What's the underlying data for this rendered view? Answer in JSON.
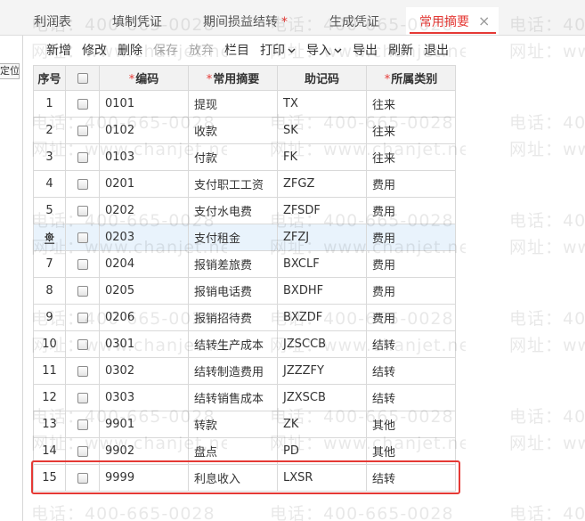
{
  "tabs": [
    {
      "label": "利润表"
    },
    {
      "label": "填制凭证"
    },
    {
      "label": "期间损益结转",
      "modified_mark": "*"
    },
    {
      "label": "生成凭证"
    },
    {
      "label": "常用摘要",
      "active": true,
      "close_glyph": "×"
    }
  ],
  "left_panel": {
    "locate_label": "定位"
  },
  "toolbar": {
    "new_label": "新增",
    "edit_label": "修改",
    "delete_label": "删除",
    "save_label": "保存",
    "save_disabled": true,
    "discard_label": "放弃",
    "discard_disabled": true,
    "columns_label": "栏目",
    "print_label": "打印",
    "import_label": "导入",
    "export_label": "导出",
    "refresh_label": "刷新",
    "exit_label": "退出"
  },
  "table": {
    "required_mark": "*",
    "header": {
      "seq": "序号",
      "code": "编码",
      "summary": "常用摘要",
      "mnemonic": "助记码",
      "category": "所属类别"
    },
    "rows": [
      {
        "seq": "1",
        "code": "0101",
        "summary": "提现",
        "mnemonic": "TX",
        "category": "往来",
        "checked": false
      },
      {
        "seq": "2",
        "code": "0102",
        "summary": "收款",
        "mnemonic": "SK",
        "category": "往来",
        "checked": false
      },
      {
        "seq": "3",
        "code": "0103",
        "summary": "付款",
        "mnemonic": "FK",
        "category": "往来",
        "checked": false
      },
      {
        "seq": "4",
        "code": "0201",
        "summary": "支付职工工资",
        "mnemonic": "ZFGZ",
        "category": "费用",
        "checked": false
      },
      {
        "seq": "5",
        "code": "0202",
        "summary": "支付水电费",
        "mnemonic": "ZFSDF",
        "category": "费用",
        "checked": false
      },
      {
        "icon": "gear-icon",
        "selected": true,
        "code": "0203",
        "summary": "支付租金",
        "mnemonic": "ZFZJ",
        "category": "费用",
        "checked": false
      },
      {
        "seq": "7",
        "code": "0204",
        "summary": "报销差旅费",
        "mnemonic": "BXCLF",
        "category": "费用",
        "checked": false
      },
      {
        "seq": "8",
        "code": "0205",
        "summary": "报销电话费",
        "mnemonic": "BXDHF",
        "category": "费用",
        "checked": false
      },
      {
        "seq": "9",
        "code": "0206",
        "summary": "报销招待费",
        "mnemonic": "BXZDF",
        "category": "费用",
        "checked": false
      },
      {
        "seq": "10",
        "code": "0301",
        "summary": "结转生产成本",
        "mnemonic": "JZSCCB",
        "category": "结转",
        "checked": false
      },
      {
        "seq": "11",
        "code": "0302",
        "summary": "结转制造费用",
        "mnemonic": "JZZZFY",
        "category": "结转",
        "checked": false
      },
      {
        "seq": "12",
        "code": "0303",
        "summary": "结转销售成本",
        "mnemonic": "JZXSCB",
        "category": "结转",
        "checked": false
      },
      {
        "seq": "13",
        "code": "9901",
        "summary": "转款",
        "mnemonic": "ZK",
        "category": "其他",
        "checked": false
      },
      {
        "seq": "14",
        "code": "9902",
        "summary": "盘点",
        "mnemonic": "PD",
        "category": "其他",
        "checked": false
      },
      {
        "seq": "15",
        "code": "9999",
        "summary": "利息收入",
        "mnemonic": "LXSR",
        "category": "结转",
        "checked": false
      }
    ]
  },
  "watermark": {
    "phone": "电话：400-665-0028",
    "site": "网址：www.chanjet.net"
  },
  "icons": {
    "row_action": "gear-icon",
    "dropdown": "chevron-down-icon",
    "tab_close": "close-icon"
  },
  "colors": {
    "accent": "#e53935",
    "selected_row": "#e9f3fc",
    "header_bg": "#f2f2f2",
    "disabled_text": "#aaaaaa",
    "annotation_box": "#e53935"
  }
}
